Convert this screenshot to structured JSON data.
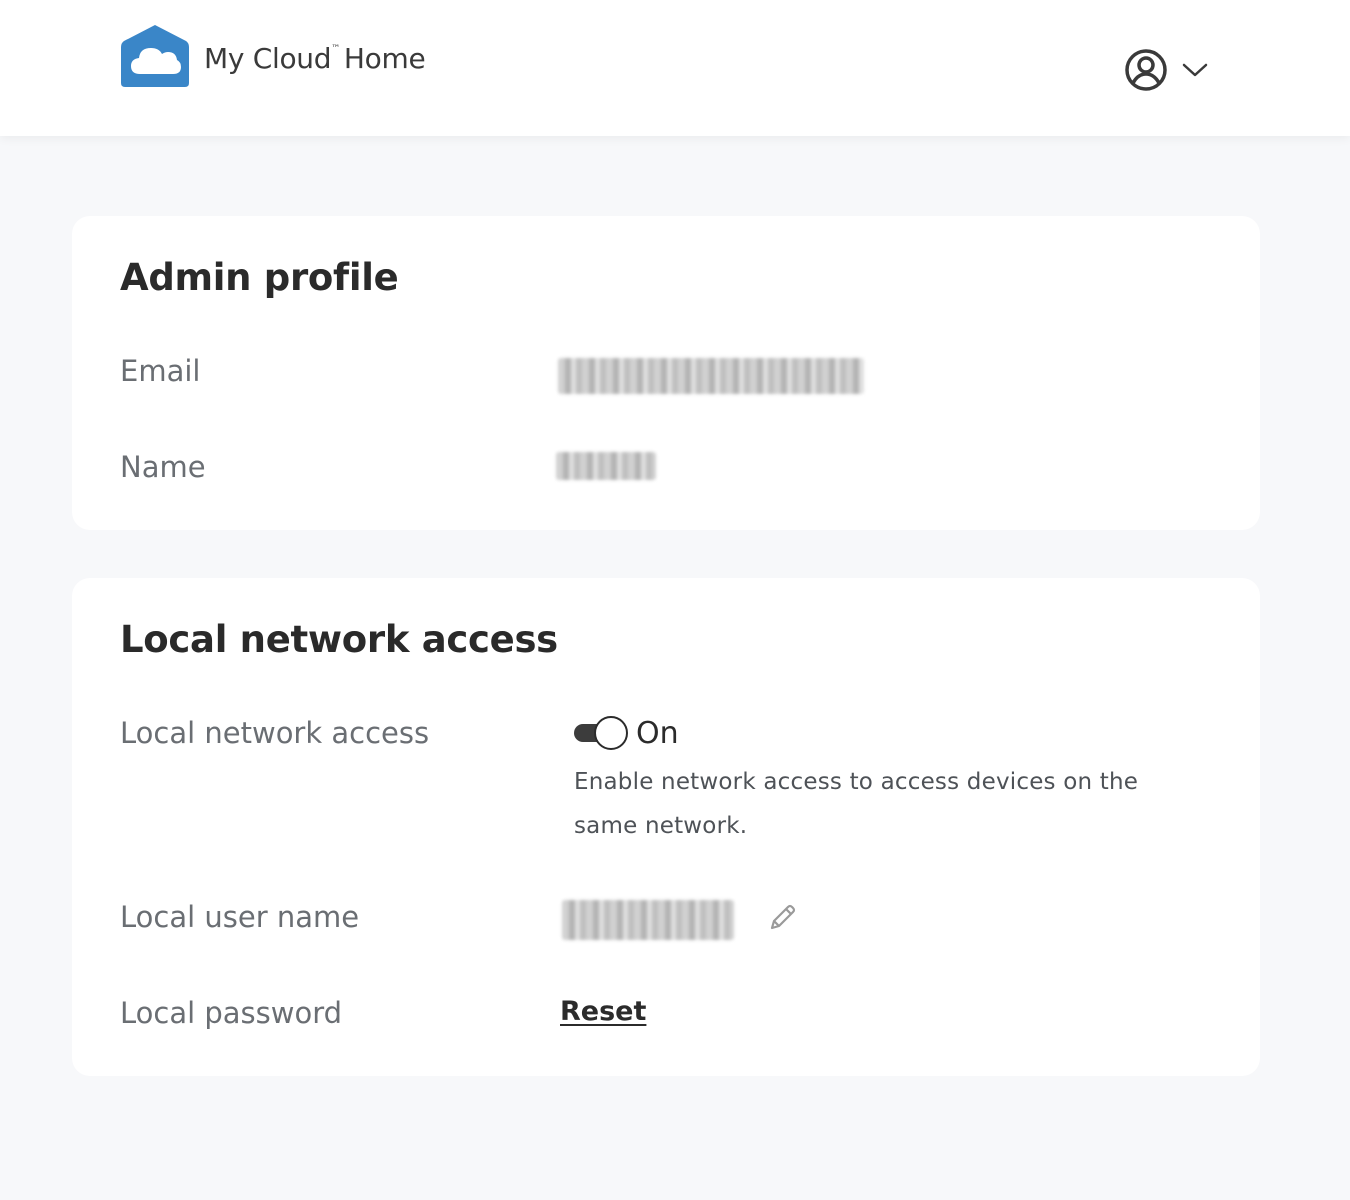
{
  "header": {
    "brand_part1": "My Cloud",
    "trademark": "™",
    "brand_part2": "Home",
    "logo_icon": "cloud-house-icon",
    "account_icon": "user-circle-icon",
    "account_menu_icon": "chevron-down-icon",
    "accent_color": "#3a86c8"
  },
  "admin_profile": {
    "title": "Admin profile",
    "email_label": "Email",
    "name_label": "Name"
  },
  "local_network": {
    "title": "Local network access",
    "access_label": "Local network access",
    "toggle_state": "On",
    "toggle_on": true,
    "help_text": "Enable network access to access devices on the same network.",
    "user_label": "Local user name",
    "edit_icon": "pencil-icon",
    "password_label": "Local password",
    "reset_label": "Reset"
  }
}
